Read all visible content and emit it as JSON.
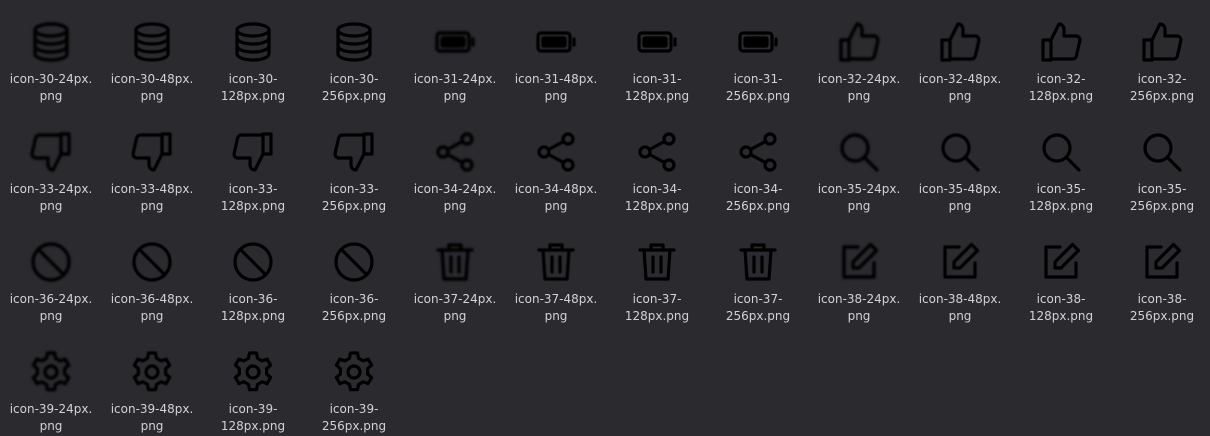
{
  "colors": {
    "background": "#2b2a2f",
    "label": "#d2d1d6",
    "icon": "#000000"
  },
  "files": [
    {
      "name": "icon-30-24px.\npng",
      "icon": "database-icon",
      "size": "s24"
    },
    {
      "name": "icon-30-48px.\npng",
      "icon": "database-icon",
      "size": "s48"
    },
    {
      "name": "icon-30-\n128px.png",
      "icon": "database-icon",
      "size": "s128"
    },
    {
      "name": "icon-30-\n256px.png",
      "icon": "database-icon",
      "size": "s256"
    },
    {
      "name": "icon-31-24px.\npng",
      "icon": "battery-icon",
      "size": "s24"
    },
    {
      "name": "icon-31-48px.\npng",
      "icon": "battery-icon",
      "size": "s48"
    },
    {
      "name": "icon-31-\n128px.png",
      "icon": "battery-icon",
      "size": "s128"
    },
    {
      "name": "icon-31-\n256px.png",
      "icon": "battery-icon",
      "size": "s256"
    },
    {
      "name": "icon-32-24px.\npng",
      "icon": "thumbs-up-icon",
      "size": "s24"
    },
    {
      "name": "icon-32-48px.\npng",
      "icon": "thumbs-up-icon",
      "size": "s48"
    },
    {
      "name": "icon-32-\n128px.png",
      "icon": "thumbs-up-icon",
      "size": "s128"
    },
    {
      "name": "icon-32-\n256px.png",
      "icon": "thumbs-up-icon",
      "size": "s256"
    },
    {
      "name": "icon-33-24px.\npng",
      "icon": "thumbs-down-icon",
      "size": "s24"
    },
    {
      "name": "icon-33-48px.\npng",
      "icon": "thumbs-down-icon",
      "size": "s48"
    },
    {
      "name": "icon-33-\n128px.png",
      "icon": "thumbs-down-icon",
      "size": "s128"
    },
    {
      "name": "icon-33-\n256px.png",
      "icon": "thumbs-down-icon",
      "size": "s256"
    },
    {
      "name": "icon-34-24px.\npng",
      "icon": "share-icon",
      "size": "s24"
    },
    {
      "name": "icon-34-48px.\npng",
      "icon": "share-icon",
      "size": "s48"
    },
    {
      "name": "icon-34-\n128px.png",
      "icon": "share-icon",
      "size": "s128"
    },
    {
      "name": "icon-34-\n256px.png",
      "icon": "share-icon",
      "size": "s256"
    },
    {
      "name": "icon-35-24px.\npng",
      "icon": "search-icon",
      "size": "s24"
    },
    {
      "name": "icon-35-48px.\npng",
      "icon": "search-icon",
      "size": "s48"
    },
    {
      "name": "icon-35-\n128px.png",
      "icon": "search-icon",
      "size": "s128"
    },
    {
      "name": "icon-35-\n256px.png",
      "icon": "search-icon",
      "size": "s256"
    },
    {
      "name": "icon-36-24px.\npng",
      "icon": "ban-icon",
      "size": "s24"
    },
    {
      "name": "icon-36-48px.\npng",
      "icon": "ban-icon",
      "size": "s48"
    },
    {
      "name": "icon-36-\n128px.png",
      "icon": "ban-icon",
      "size": "s128"
    },
    {
      "name": "icon-36-\n256px.png",
      "icon": "ban-icon",
      "size": "s256"
    },
    {
      "name": "icon-37-24px.\npng",
      "icon": "trash-icon",
      "size": "s24"
    },
    {
      "name": "icon-37-48px.\npng",
      "icon": "trash-icon",
      "size": "s48"
    },
    {
      "name": "icon-37-\n128px.png",
      "icon": "trash-icon",
      "size": "s128"
    },
    {
      "name": "icon-37-\n256px.png",
      "icon": "trash-icon",
      "size": "s256"
    },
    {
      "name": "icon-38-24px.\npng",
      "icon": "edit-icon",
      "size": "s24"
    },
    {
      "name": "icon-38-48px.\npng",
      "icon": "edit-icon",
      "size": "s48"
    },
    {
      "name": "icon-38-\n128px.png",
      "icon": "edit-icon",
      "size": "s128"
    },
    {
      "name": "icon-38-\n256px.png",
      "icon": "edit-icon",
      "size": "s256"
    },
    {
      "name": "icon-39-24px.\npng",
      "icon": "settings-icon",
      "size": "s24"
    },
    {
      "name": "icon-39-48px.\npng",
      "icon": "settings-icon",
      "size": "s48"
    },
    {
      "name": "icon-39-\n128px.png",
      "icon": "settings-icon",
      "size": "s128"
    },
    {
      "name": "icon-39-\n256px.png",
      "icon": "settings-icon",
      "size": "s256"
    }
  ]
}
